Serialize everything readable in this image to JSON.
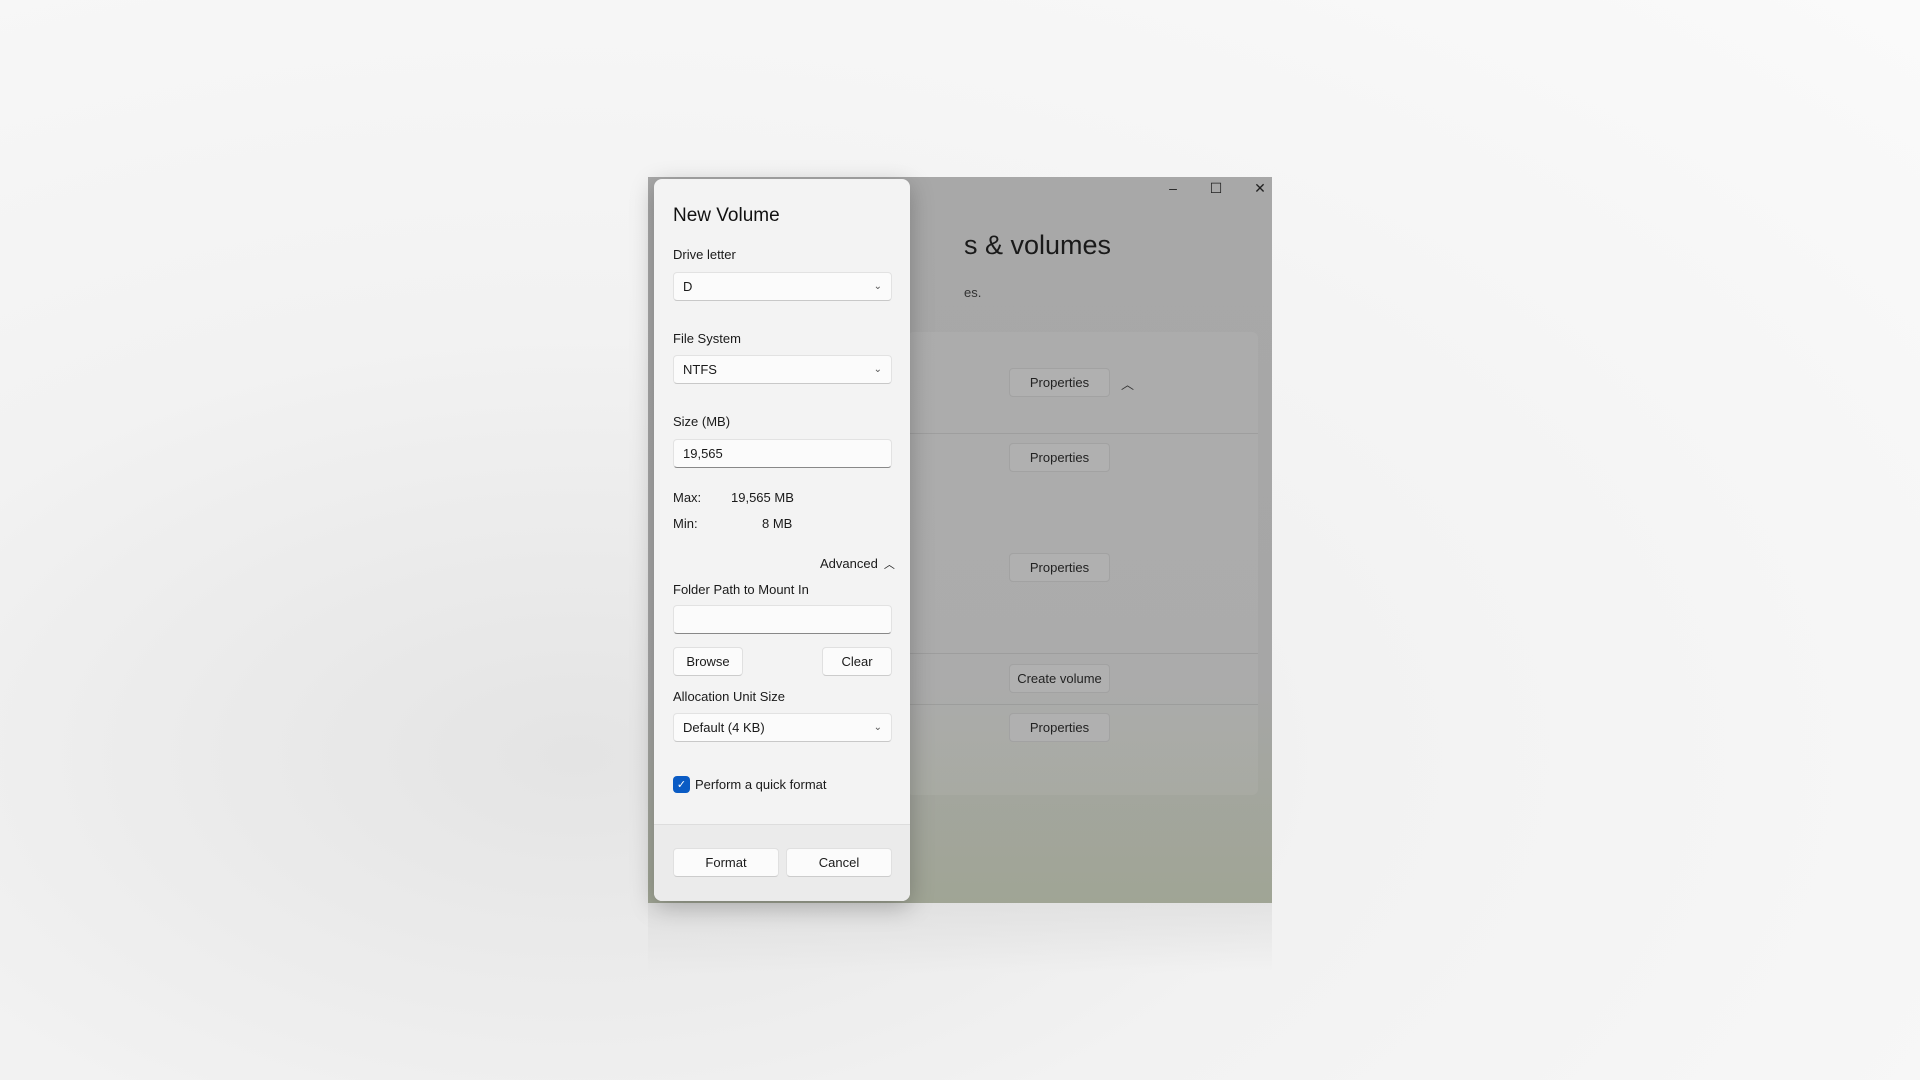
{
  "background_window": {
    "title_partial": "s & volumes",
    "subtitle_partial": "es.",
    "controls": {
      "minimize": "–",
      "maximize": "☐",
      "close": "✕"
    },
    "buttons": [
      "Properties",
      "Properties",
      "Properties",
      "Create volume",
      "Properties"
    ]
  },
  "dialog": {
    "title": "New Volume",
    "drive_letter": {
      "label": "Drive letter",
      "value": "D"
    },
    "file_system": {
      "label": "File System",
      "value": "NTFS"
    },
    "size": {
      "label": "Size (MB)",
      "value": "19,565"
    },
    "max": {
      "label": "Max:",
      "value": "19,565 MB"
    },
    "min": {
      "label": "Min:",
      "value": "8 MB"
    },
    "advanced_label": "Advanced",
    "folder_path": {
      "label": "Folder Path to Mount In",
      "value": ""
    },
    "browse_label": "Browse",
    "clear_label": "Clear",
    "allocation": {
      "label": "Allocation Unit Size",
      "value": "Default (4 KB)"
    },
    "quick_format": {
      "label": "Perform a quick format",
      "checked": true
    },
    "format_label": "Format",
    "cancel_label": "Cancel",
    "accent_color": "#0a5bc4"
  }
}
